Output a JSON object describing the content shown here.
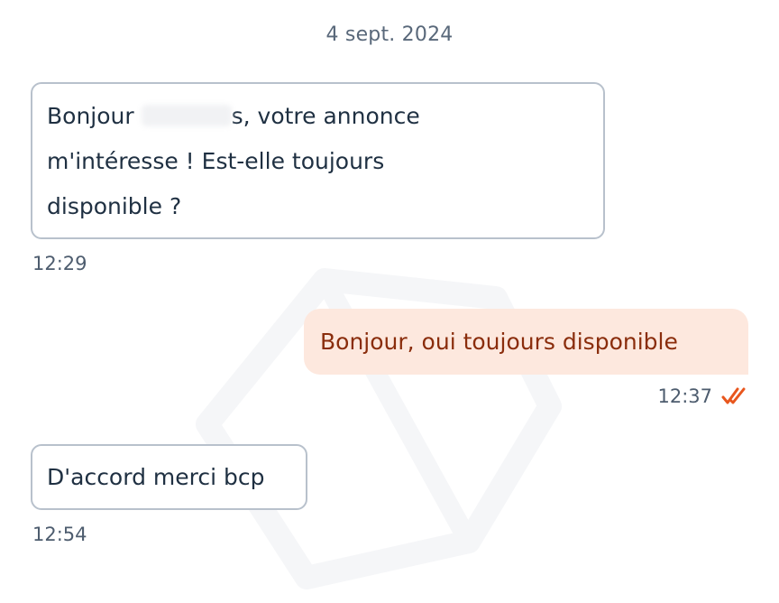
{
  "conversation": {
    "date_separator": "4 sept. 2024",
    "messages": [
      {
        "direction": "incoming",
        "text_before_redaction": "Bonjour ",
        "text_after_redaction": "s, votre annonce m'intéresse ! Est-elle toujours disponible ?",
        "time": "12:29"
      },
      {
        "direction": "outgoing",
        "text": "Bonjour, oui toujours disponible",
        "time": "12:37",
        "status_icon": "double-check-icon"
      },
      {
        "direction": "incoming",
        "text": "D'accord merci bcp",
        "time": "12:54"
      }
    ]
  },
  "colors": {
    "outgoing_bubble_bg": "#fde8de",
    "outgoing_text": "#8a2d0c",
    "incoming_border": "#b8c1cc",
    "read_check": "#e8561d",
    "timestamp": "#4d5c6e"
  }
}
